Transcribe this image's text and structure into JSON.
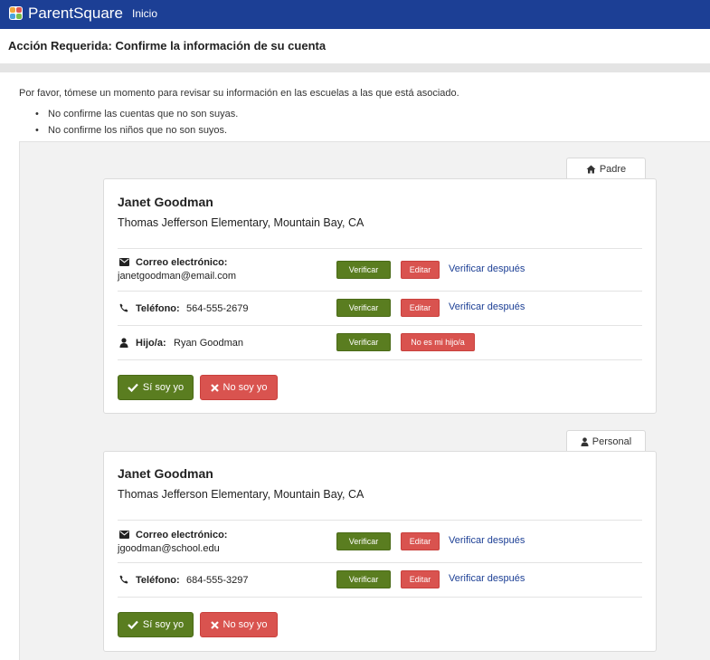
{
  "app": {
    "brand": "ParentSquare",
    "nav_link": "Inicio"
  },
  "page": {
    "title": "Acción Requerida: Confirme la información de su cuenta",
    "intro": "Por favor, tómese un momento para revisar su información en las escuelas a las que está asociado.",
    "bullets": [
      "No confirme las cuentas que no son suyas.",
      "No confirme los niños que no son suyos."
    ]
  },
  "cards": [
    {
      "tab_label": "Padre",
      "tab_icon": "home-icon",
      "name": "Janet Goodman",
      "school": "Thomas Jefferson Elementary, Mountain Bay, CA",
      "email_label": "Correo electrónico:",
      "email_value": "janetgoodman@email.com",
      "phone_label": "Teléfono:",
      "phone_value": "564-555-2679",
      "child_label": "Hijo/a:",
      "child_value": "Ryan Goodman",
      "verify_label": "Verificar",
      "edit_label": "Editar",
      "later_label": "Verificar después",
      "not_my_child_label": "No es mi hijo/a",
      "yes_label": "Sí soy yo",
      "no_label": "No soy yo"
    },
    {
      "tab_label": "Personal",
      "tab_icon": "user-icon",
      "name": "Janet Goodman",
      "school": "Thomas Jefferson Elementary, Mountain Bay, CA",
      "email_label": "Correo electrónico:",
      "email_value": "jgoodman@school.edu",
      "phone_label": "Teléfono:",
      "phone_value": "684-555-3297",
      "verify_label": "Verificar",
      "edit_label": "Editar",
      "later_label": "Verificar después",
      "yes_label": "Sí soy yo",
      "no_label": "No soy yo"
    }
  ],
  "colors": {
    "nav": "#1c3f95",
    "green": "#5a7d20",
    "red": "#d9534f",
    "link": "#1c3f95"
  }
}
